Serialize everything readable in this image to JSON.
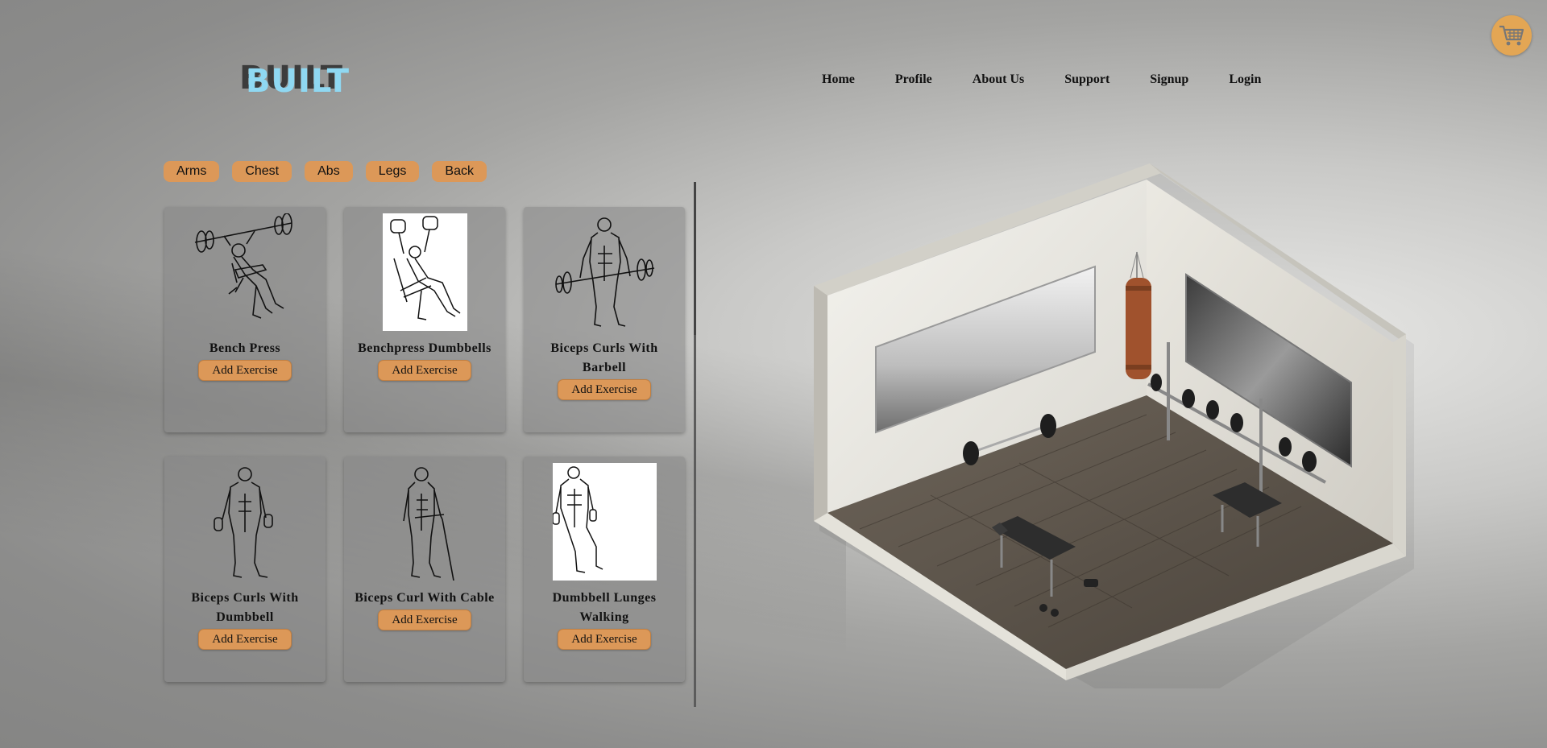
{
  "logo": {
    "text": "BUILT"
  },
  "nav": {
    "items": [
      "Home",
      "Profile",
      "About Us",
      "Support",
      "Signup",
      "Login"
    ]
  },
  "cart": {
    "icon": "shopping-cart-icon"
  },
  "categories": [
    "Arms",
    "Chest",
    "Abs",
    "Legs",
    "Back"
  ],
  "exercises": [
    {
      "name": "Bench Press",
      "button": "Add Exercise"
    },
    {
      "name": "Benchpress Dumbbells",
      "button": "Add Exercise"
    },
    {
      "name": "Biceps Curls With Barbell",
      "button": "Add Exercise"
    },
    {
      "name": "Biceps Curls With Dumbbell",
      "button": "Add Exercise"
    },
    {
      "name": "Biceps Curl With Cable",
      "button": "Add Exercise"
    },
    {
      "name": "Dumbbell Lunges Walking",
      "button": "Add Exercise"
    }
  ],
  "colors": {
    "accent": "#dc9858",
    "logo": "#8fd8f2",
    "cart": "#e3a654"
  }
}
